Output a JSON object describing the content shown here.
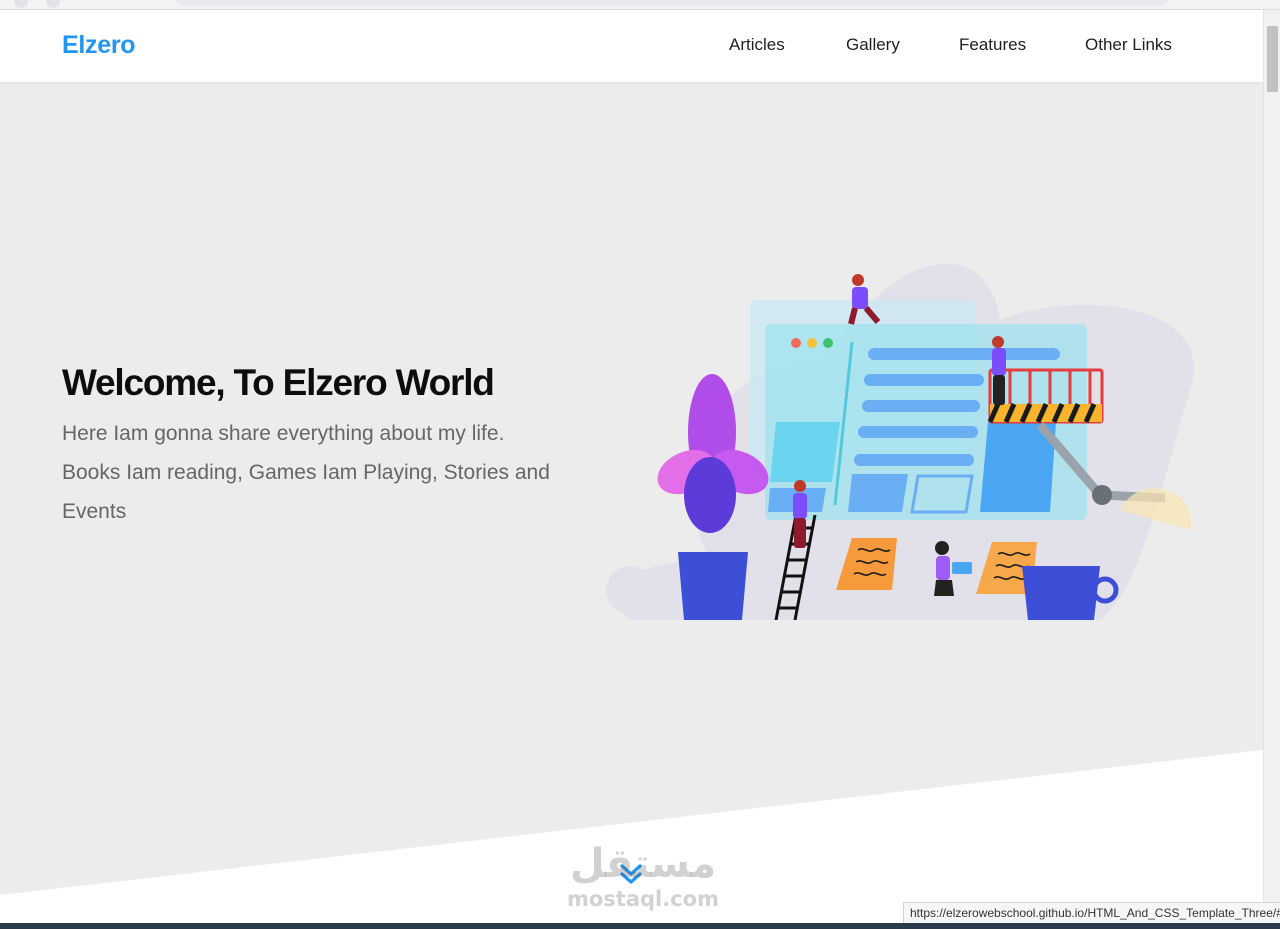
{
  "header": {
    "logo": "Elzero",
    "nav": [
      {
        "label": "Articles"
      },
      {
        "label": "Gallery"
      },
      {
        "label": "Features"
      },
      {
        "label": "Other Links"
      }
    ]
  },
  "hero": {
    "title": "Welcome, To Elzero World",
    "description_lines": [
      "Here Iam gonna share everything about my life.",
      "Books Iam reading, Games Iam Playing, Stories and",
      "Events"
    ],
    "illustration_icon": "workspace-illustration"
  },
  "scroll_down_icon": "double-chevron-down-icon",
  "watermark": {
    "arabic": "مستقل",
    "latin": "mostaql.com"
  },
  "status_bar": {
    "url": "https://elzerowebschool.github.io/HTML_And_CSS_Template_Three/#"
  },
  "colors": {
    "brand": "#2196f3",
    "hero_background": "#ececec",
    "title": "#0d0d0d",
    "description": "#666666"
  }
}
